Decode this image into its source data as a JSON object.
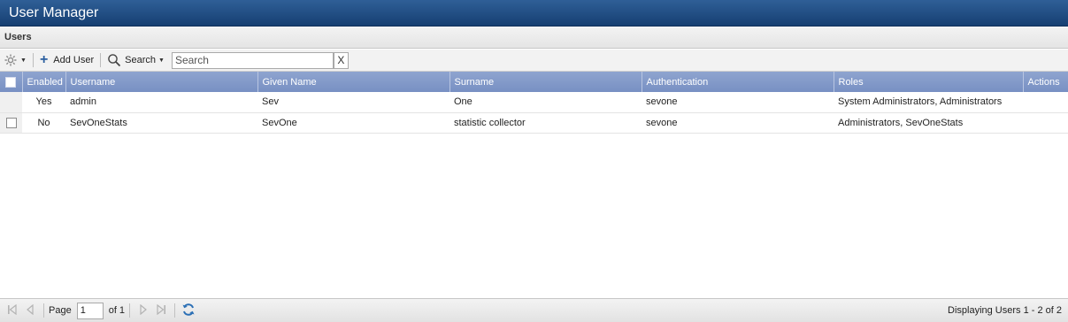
{
  "window": {
    "title": "User Manager"
  },
  "panel": {
    "title": "Users"
  },
  "toolbar": {
    "add_user_label": "Add User",
    "search_menu_label": "Search",
    "search_placeholder": "Search",
    "clear_label": "X"
  },
  "grid": {
    "columns": [
      "Enabled",
      "Username",
      "Given Name",
      "Surname",
      "Authentication",
      "Roles",
      "Actions"
    ],
    "rows": [
      {
        "enabled": "Yes",
        "username": "admin",
        "given_name": "Sev",
        "surname": "One",
        "authentication": "sevone",
        "roles": "System Administrators, Administrators",
        "actions": ""
      },
      {
        "enabled": "No",
        "username": "SevOneStats",
        "given_name": "SevOne",
        "surname": "statistic collector",
        "authentication": "sevone",
        "roles": "Administrators, SevOneStats",
        "actions": ""
      }
    ]
  },
  "pager": {
    "page_label": "Page",
    "page_value": "1",
    "of_label": "of 1",
    "display_info": "Displaying Users 1 - 2 of 2"
  },
  "icons": {
    "settings": "gear-icon",
    "add": "plus-icon",
    "search": "magnifier-icon",
    "refresh": "refresh-icon"
  },
  "colors": {
    "titlebar": "#1f4d85",
    "grid_header": "#8299c9",
    "accent": "#2b5fa0"
  }
}
